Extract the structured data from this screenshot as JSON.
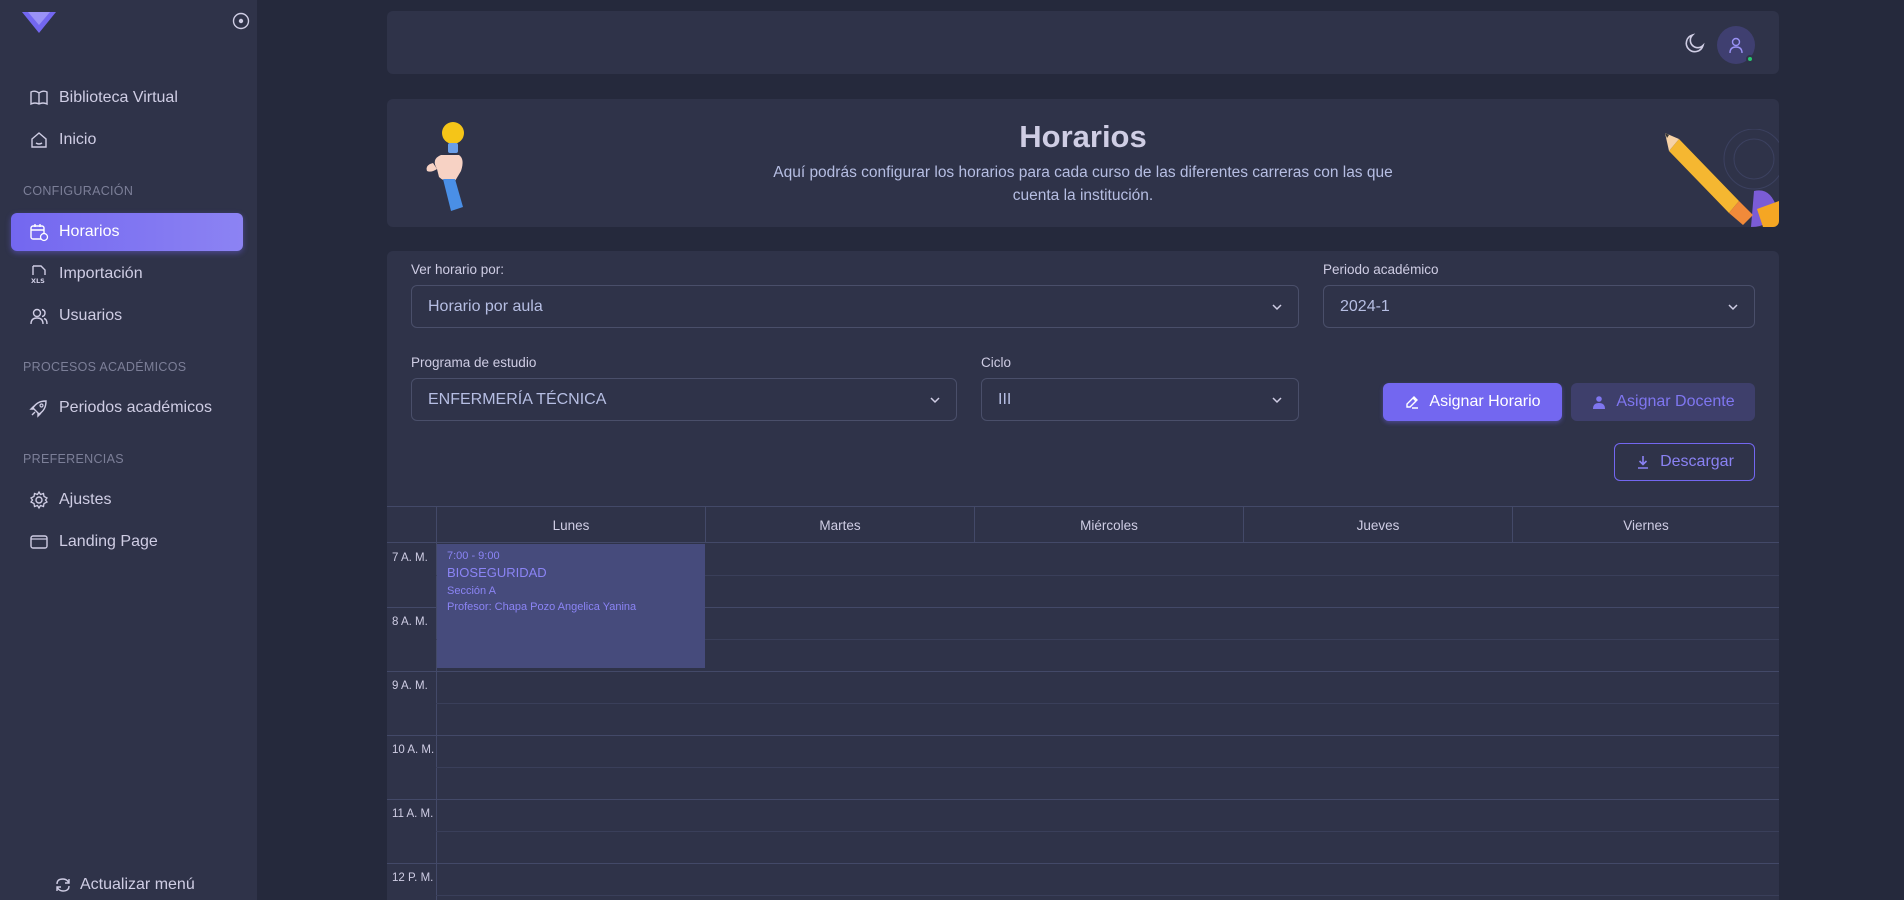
{
  "sidebar": {
    "nav_top": [
      {
        "label": "Biblioteca Virtual",
        "icon": "book-icon"
      },
      {
        "label": "Inicio",
        "icon": "home-icon"
      }
    ],
    "sections": {
      "config": "CONFIGURACIÓN",
      "procesos": "PROCESOS ACADÉMICOS",
      "preferencias": "PREFERENCIAS"
    },
    "config_items": [
      {
        "label": "Horarios",
        "icon": "calendar-clock-icon",
        "active": true
      },
      {
        "label": "Importación",
        "icon": "xls-file-icon"
      },
      {
        "label": "Usuarios",
        "icon": "users-icon"
      }
    ],
    "procesos_items": [
      {
        "label": "Periodos académicos",
        "icon": "rocket-icon"
      }
    ],
    "pref_items": [
      {
        "label": "Ajustes",
        "icon": "gear-icon"
      },
      {
        "label": "Landing Page",
        "icon": "browser-icon"
      }
    ],
    "refresh_label": "Actualizar menú"
  },
  "header": {
    "title": "Horarios",
    "subtitle": "Aquí podrás configurar los horarios para cada curso de las diferentes carreras con las que cuenta la institución."
  },
  "filters": {
    "view_by_label": "Ver horario por:",
    "view_by_value": "Horario por aula",
    "period_label": "Periodo académico",
    "period_value": "2024-1",
    "program_label": "Programa de estudio",
    "program_value": "ENFERMERÍA TÉCNICA",
    "cycle_label": "Ciclo",
    "cycle_value": "III"
  },
  "actions": {
    "assign_schedule": "Asignar Horario",
    "assign_teacher": "Asignar Docente",
    "download": "Descargar"
  },
  "calendar": {
    "days": [
      "Lunes",
      "Martes",
      "Miércoles",
      "Jueves",
      "Viernes"
    ],
    "hours": [
      "7 A. M.",
      "8 A. M.",
      "9 A. M.",
      "10 A. M.",
      "11 A. M.",
      "12 P. M."
    ],
    "event": {
      "time": "7:00 - 9:00",
      "title": "BIOSEGURIDAD",
      "section": "Sección A",
      "professor": "Profesor: Chapa Pozo Angelica Yanina",
      "day": "Lunes"
    }
  },
  "colors": {
    "primary": "#7367f0",
    "background": "#25293c",
    "card": "#2f3349",
    "online": "#28c76f"
  }
}
